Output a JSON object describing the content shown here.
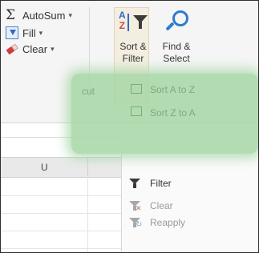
{
  "ribbon": {
    "autosum": {
      "label": "AutoSum",
      "dropdown": "▾",
      "icon": "sigma-icon"
    },
    "fill": {
      "label": "Fill",
      "dropdown": "▾",
      "icon": "fill-down-icon"
    },
    "clear": {
      "label": "Clear",
      "dropdown": "▾",
      "icon": "eraser-icon"
    },
    "sort_filter": {
      "line1": "Sort &",
      "line2": "Filter",
      "dropdown": "▾",
      "icon": "sort-az-filter-icon"
    },
    "find_select": {
      "line1": "Find &",
      "line2": "Select",
      "dropdown": "▾",
      "icon": "magnifier-icon"
    }
  },
  "overlay": {
    "left_text": "cut",
    "item1": "Sort A to Z",
    "item2": "Sort Z to A"
  },
  "sheet": {
    "column_header": "U"
  },
  "menu": {
    "items": [
      {
        "label": "Filter",
        "enabled": true,
        "icon": "filter-icon"
      },
      {
        "label": "Clear",
        "enabled": false,
        "icon": "clear-filter-icon"
      },
      {
        "label": "Reapply",
        "enabled": false,
        "icon": "reapply-filter-icon"
      }
    ]
  },
  "colors": {
    "accent_blue": "#2f7bd0",
    "overlay_green": "#a9d8a8",
    "frame_border": "#2f2f2f"
  }
}
